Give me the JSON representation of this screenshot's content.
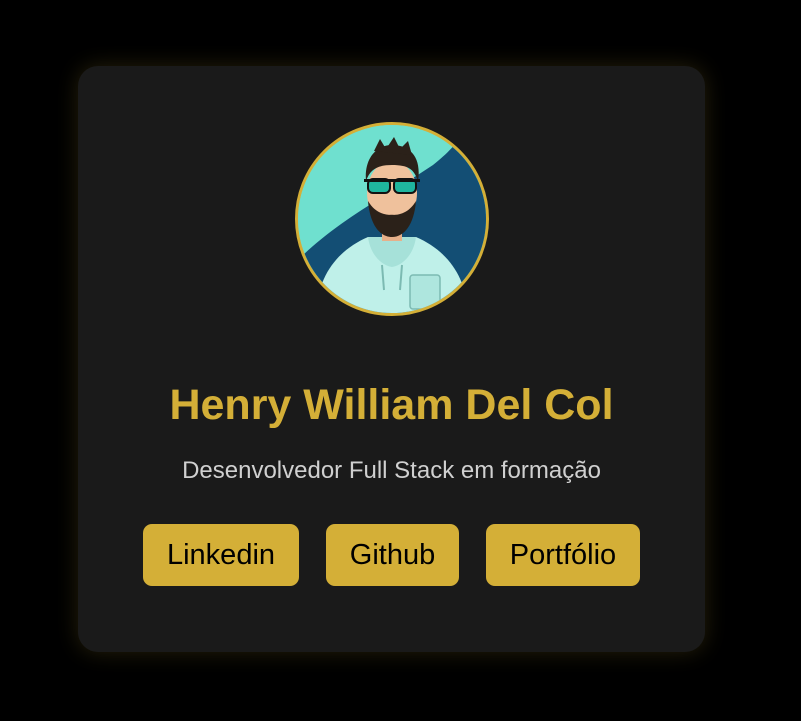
{
  "profile": {
    "name": "Henry William Del Col",
    "subtitle": "Desenvolvedor Full Stack em formação",
    "avatar_icon": "developer-avatar-illustration"
  },
  "links": {
    "linkedin_label": "Linkedin",
    "github_label": "Github",
    "portfolio_label": "Portfólio"
  },
  "colors": {
    "background": "#000000",
    "card": "#1a1a1a",
    "accent": "#d4af37",
    "subtitle_text": "#d0d0d0",
    "button_text": "#000000"
  }
}
